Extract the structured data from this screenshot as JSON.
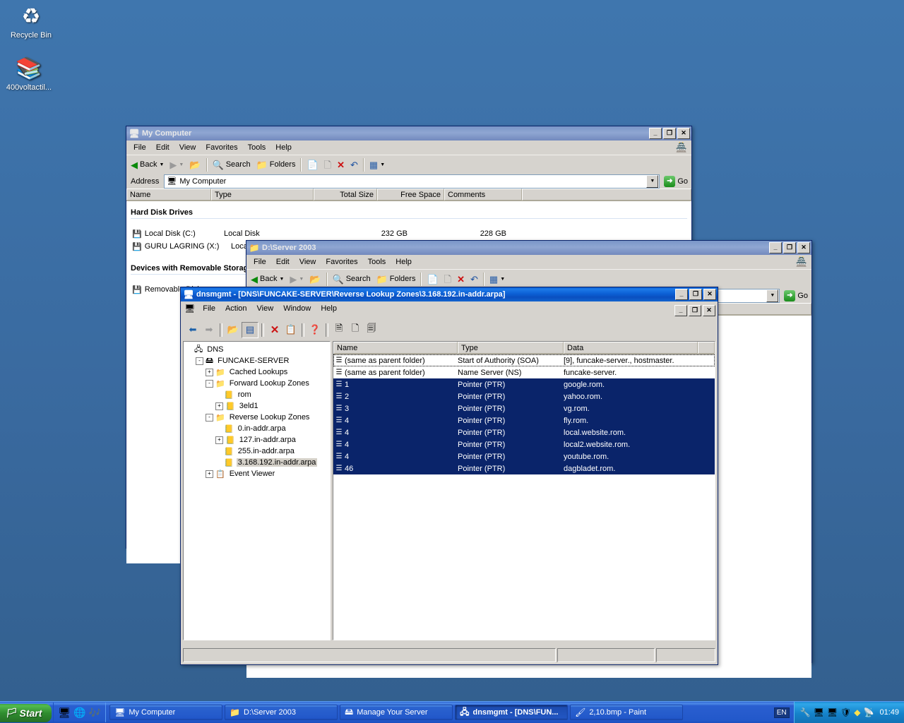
{
  "desktop": {
    "icons": [
      {
        "name": "Recycle Bin",
        "glyph": "♻"
      },
      {
        "name": "400voltactil...",
        "glyph": "📚"
      }
    ]
  },
  "my_computer": {
    "title": "My Computer",
    "menu": [
      "File",
      "Edit",
      "View",
      "Favorites",
      "Tools",
      "Help"
    ],
    "toolbar": {
      "back": "Back",
      "search": "Search",
      "folders": "Folders"
    },
    "address": {
      "label": "Address",
      "value": "My Computer",
      "go": "Go"
    },
    "columns": [
      "Name",
      "Type",
      "Total Size",
      "Free Space",
      "Comments"
    ],
    "groups": [
      {
        "header": "Hard Disk Drives",
        "rows": [
          {
            "name": "Local Disk (C:)",
            "type": "Local Disk",
            "size": "232 GB",
            "free": "228 GB",
            "comments": ""
          },
          {
            "name": "GURU LAGRING (X:)",
            "type": "Local Disk",
            "size": "",
            "free": "",
            "comments": ""
          }
        ]
      },
      {
        "header": "Devices with Removable Storage",
        "rows": [
          {
            "name": "Removable Disk",
            "type": "",
            "size": "",
            "free": "",
            "comments": ""
          }
        ]
      }
    ]
  },
  "server_window": {
    "title": "D:\\Server 2003",
    "menu": [
      "File",
      "Edit",
      "View",
      "Favorites",
      "Tools",
      "Help"
    ],
    "toolbar": {
      "back": "Back",
      "search": "Search",
      "folders": "Folders"
    },
    "address": {
      "label": "Address",
      "value": "",
      "go": "Go"
    }
  },
  "dns": {
    "title": "dnsmgmt - [DNS\\FUNCAKE-SERVER\\Reverse Lookup Zones\\3.168.192.in-addr.arpa]",
    "menu": [
      "File",
      "Action",
      "View",
      "Window",
      "Help"
    ],
    "tree": [
      {
        "label": "DNS",
        "indent": 0,
        "expander": "",
        "icon": "🖧",
        "selected": false
      },
      {
        "label": "FUNCAKE-SERVER",
        "indent": 1,
        "expander": "-",
        "icon": "🖴",
        "selected": false
      },
      {
        "label": "Cached Lookups",
        "indent": 2,
        "expander": "+",
        "icon": "📁",
        "selected": false
      },
      {
        "label": "Forward Lookup Zones",
        "indent": 2,
        "expander": "-",
        "icon": "📁",
        "selected": false
      },
      {
        "label": "rom",
        "indent": 3,
        "expander": "",
        "icon": "📒",
        "selected": false
      },
      {
        "label": "3eld1",
        "indent": 3,
        "expander": "+",
        "icon": "📒",
        "selected": false
      },
      {
        "label": "Reverse Lookup Zones",
        "indent": 2,
        "expander": "-",
        "icon": "📁",
        "selected": false
      },
      {
        "label": "0.in-addr.arpa",
        "indent": 3,
        "expander": "",
        "icon": "📒",
        "selected": false
      },
      {
        "label": "127.in-addr.arpa",
        "indent": 3,
        "expander": "+",
        "icon": "📒",
        "selected": false
      },
      {
        "label": "255.in-addr.arpa",
        "indent": 3,
        "expander": "",
        "icon": "📒",
        "selected": false
      },
      {
        "label": "3.168.192.in-addr.arpa",
        "indent": 3,
        "expander": "",
        "icon": "📒",
        "selected": true
      },
      {
        "label": "Event Viewer",
        "indent": 2,
        "expander": "+",
        "icon": "📋",
        "selected": false
      }
    ],
    "columns": [
      "Name",
      "Type",
      "Data"
    ],
    "records": [
      {
        "name": "(same as parent folder)",
        "type": "Start of Authority (SOA)",
        "data": "[9], funcake-server., hostmaster.",
        "selected": false,
        "focused": true
      },
      {
        "name": "(same as parent folder)",
        "type": "Name Server (NS)",
        "data": "funcake-server.",
        "selected": false,
        "focused": false
      },
      {
        "name": "1",
        "type": "Pointer (PTR)",
        "data": "google.rom.",
        "selected": true,
        "focused": false
      },
      {
        "name": "2",
        "type": "Pointer (PTR)",
        "data": "yahoo.rom.",
        "selected": true,
        "focused": false
      },
      {
        "name": "3",
        "type": "Pointer (PTR)",
        "data": "vg.rom.",
        "selected": true,
        "focused": false
      },
      {
        "name": "4",
        "type": "Pointer (PTR)",
        "data": "fly.rom.",
        "selected": true,
        "focused": false
      },
      {
        "name": "4",
        "type": "Pointer (PTR)",
        "data": "local.website.rom.",
        "selected": true,
        "focused": false
      },
      {
        "name": "4",
        "type": "Pointer (PTR)",
        "data": "local2.website.rom.",
        "selected": true,
        "focused": false
      },
      {
        "name": "4",
        "type": "Pointer (PTR)",
        "data": "youtube.rom.",
        "selected": true,
        "focused": false
      },
      {
        "name": "46",
        "type": "Pointer (PTR)",
        "data": "dagbladet.rom.",
        "selected": true,
        "focused": false
      }
    ],
    "status": [
      "",
      "",
      ""
    ]
  },
  "taskbar": {
    "start": "Start",
    "quick_icons": [
      "show-desktop-icon",
      "internet-explorer-icon",
      "media-player-icon"
    ],
    "buttons": [
      {
        "label": "My Computer",
        "icon": "🖥",
        "active": false
      },
      {
        "label": "D:\\Server 2003",
        "icon": "📁",
        "active": false
      },
      {
        "label": "Manage Your Server",
        "icon": "🖴",
        "active": false
      },
      {
        "label": "dnsmgmt - [DNS\\FUN...",
        "icon": "🖧",
        "active": true
      },
      {
        "label": "2,10.bmp - Paint",
        "icon": "🖌",
        "active": false
      }
    ],
    "language": "EN",
    "tray_icons": [
      "🔧",
      "🖧",
      "🖧",
      "🛡",
      "◆",
      "📡"
    ],
    "clock": "01:49"
  },
  "window_buttons": {
    "min": "_",
    "max": "❐",
    "restore": "❐",
    "close": "✕"
  }
}
